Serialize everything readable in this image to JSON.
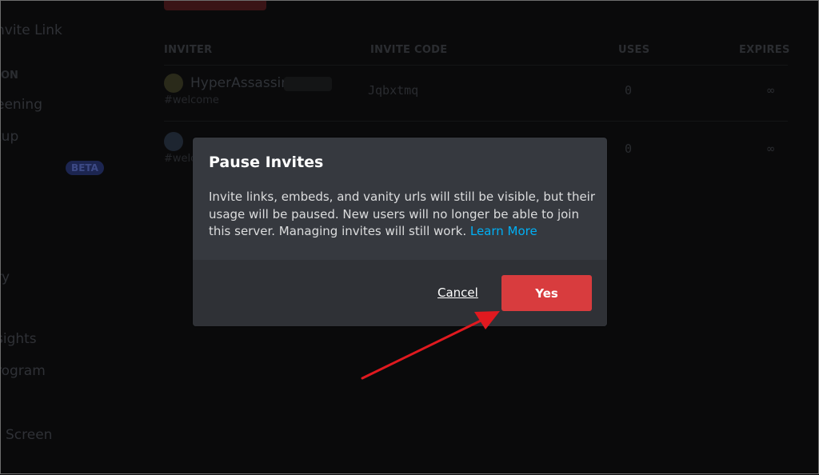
{
  "sidebar": {
    "items": [
      {
        "label": "nvite Link"
      },
      {
        "label": "ON"
      },
      {
        "label": "eening"
      },
      {
        "label": "tup"
      },
      {
        "label": "BETA"
      },
      {
        "label": "ry"
      },
      {
        "label": "sights"
      },
      {
        "label": "rogram"
      },
      {
        "label": "Screen"
      }
    ]
  },
  "table": {
    "headers": [
      "INVITER",
      "INVITE CODE",
      "USES",
      "EXPIRES"
    ],
    "rows": [
      {
        "inviter": "HyperAssassin",
        "channel": "#welcome",
        "code": "Jqbxtmq",
        "uses": "0",
        "expires": "∞"
      },
      {
        "inviter": "",
        "channel": "#welc",
        "code": "",
        "uses": "0",
        "expires": "∞"
      }
    ]
  },
  "modal": {
    "title": "Pause Invites",
    "body": "Invite links, embeds, and vanity urls will still be visible, but their usage will be paused. New users will no longer be able to join this server. Managing invites will still work. ",
    "learn_more": "Learn More",
    "cancel_label": "Cancel",
    "confirm_label": "Yes"
  },
  "colors": {
    "modal_bg": "#36393f",
    "footer_bg": "#2f3136",
    "danger": "#d83c3e",
    "link": "#00aff4",
    "arrow": "#e0191f"
  }
}
